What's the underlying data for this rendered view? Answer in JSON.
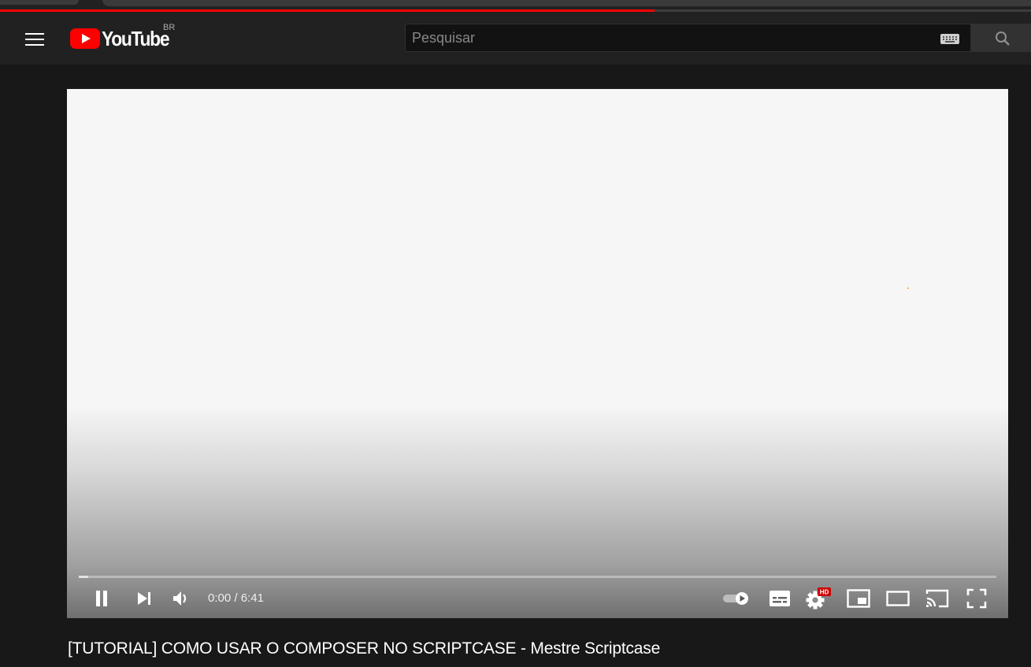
{
  "page": {
    "load_progress": 0.635
  },
  "masthead": {
    "logo_text": "YouTube",
    "country_code": "BR",
    "search_placeholder": "Pesquisar",
    "icons": [
      "menu-icon",
      "youtube-logo-icon",
      "keyboard-icon",
      "search-icon"
    ]
  },
  "player": {
    "time_current": "0:00",
    "time_separator": " / ",
    "time_total": "6:41",
    "progress": 0.0,
    "buffered": 0.01,
    "hd_badge": "HD",
    "colors": {
      "accent": "#ff0000",
      "hd_badge": "#cc0000"
    },
    "controls": [
      "pause-icon",
      "next-icon",
      "volume-icon",
      "autoplay-toggle-icon",
      "subtitles-icon",
      "settings-icon",
      "miniplayer-icon",
      "theater-icon",
      "cast-icon",
      "fullscreen-icon"
    ]
  },
  "video": {
    "title": "[TUTORIAL] COMO USAR O COMPOSER NO SCRIPTCASE - Mestre Scriptcase"
  }
}
